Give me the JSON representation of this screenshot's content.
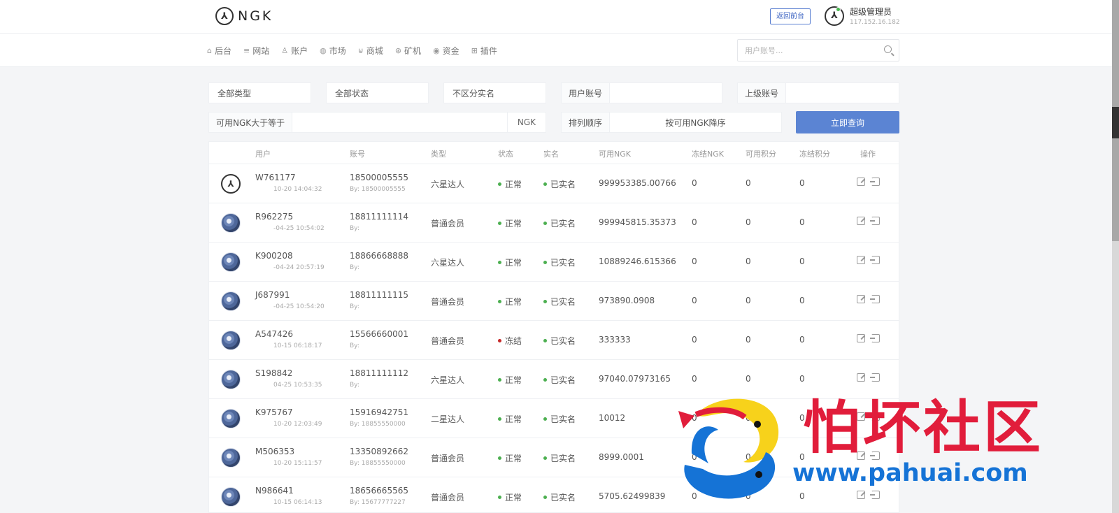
{
  "header": {
    "logo_mark": "⅄",
    "logo_text": "NGK",
    "back_button": "返回前台",
    "admin_name": "超级管理员",
    "admin_ip": "117.152.16.182"
  },
  "nav": {
    "items": [
      {
        "icon": "home-icon",
        "glyph": "⌂",
        "label": "后台"
      },
      {
        "icon": "list-icon",
        "glyph": "≡",
        "label": "网站"
      },
      {
        "icon": "users-icon",
        "glyph": "♙",
        "label": "账户"
      },
      {
        "icon": "globe-icon",
        "glyph": "◍",
        "label": "市场"
      },
      {
        "icon": "cart-icon",
        "glyph": "⊌",
        "label": "商城"
      },
      {
        "icon": "mining-icon",
        "glyph": "⊛",
        "label": "矿机"
      },
      {
        "icon": "money-icon",
        "glyph": "◉",
        "label": "资金"
      },
      {
        "icon": "plugin-icon",
        "glyph": "⊞",
        "label": "插件"
      }
    ],
    "search_placeholder": "用户账号..."
  },
  "filters": {
    "type": "全部类型",
    "status": "全部状态",
    "realname": "不区分实名",
    "account_label": "用户账号",
    "account_value": "",
    "parent_label": "上级账号",
    "parent_value": "",
    "ngk_label": "可用NGK大于等于",
    "ngk_value": "",
    "ngk_suffix": "NGK",
    "sort_label": "排列顺序",
    "sort_value": "按可用NGK降序",
    "query_button": "立即查询"
  },
  "table": {
    "headers": [
      "用户",
      "账号",
      "类型",
      "状态",
      "实名",
      "可用NGK",
      "冻结NGK",
      "可用积分",
      "冻结积分",
      "操作"
    ],
    "rows": [
      {
        "avatar": "logo",
        "uid": "W761177",
        "time": "10-20 14:04:32",
        "account": "18500005555",
        "by": "By: 18500005555",
        "type": "六星达人",
        "status": "正常",
        "status_color": "#4caf50",
        "realname": "已实名",
        "ngk": "999953385.00766",
        "frozen_ngk": "0",
        "points": "0",
        "frozen_points": "0"
      },
      {
        "avatar": "photo",
        "uid": "R962275",
        "time": "-04-25 10:54:02",
        "account": "18811111114",
        "by": "By:",
        "type": "普通会员",
        "status": "正常",
        "status_color": "#4caf50",
        "realname": "已实名",
        "ngk": "999945815.35373",
        "frozen_ngk": "0",
        "points": "0",
        "frozen_points": "0"
      },
      {
        "avatar": "photo",
        "uid": "K900208",
        "time": "-04-24 20:57:19",
        "account": "18866668888",
        "by": "By:",
        "type": "六星达人",
        "status": "正常",
        "status_color": "#4caf50",
        "realname": "已实名",
        "ngk": "10889246.615366",
        "frozen_ngk": "0",
        "points": "0",
        "frozen_points": "0"
      },
      {
        "avatar": "photo",
        "uid": "J687991",
        "time": "-04-25 10:54:20",
        "account": "18811111115",
        "by": "By:",
        "type": "普通会员",
        "status": "正常",
        "status_color": "#4caf50",
        "realname": "已实名",
        "ngk": "973890.0908",
        "frozen_ngk": "0",
        "points": "0",
        "frozen_points": "0"
      },
      {
        "avatar": "photo",
        "uid": "A547426",
        "time": "10-15 06:18:17",
        "account": "15566660001",
        "by": "By:",
        "type": "普通会员",
        "status": "冻结",
        "status_color": "#c62828",
        "realname": "已实名",
        "ngk": "333333",
        "frozen_ngk": "0",
        "points": "0",
        "frozen_points": "0"
      },
      {
        "avatar": "photo",
        "uid": "S198842",
        "time": "04-25 10:53:35",
        "account": "18811111112",
        "by": "By:",
        "type": "六星达人",
        "status": "正常",
        "status_color": "#4caf50",
        "realname": "已实名",
        "ngk": "97040.07973165",
        "frozen_ngk": "0",
        "points": "0",
        "frozen_points": "0"
      },
      {
        "avatar": "photo",
        "uid": "K975767",
        "time": "10-20 12:03:49",
        "account": "15916942751",
        "by": "By: 18855550000",
        "type": "二星达人",
        "status": "正常",
        "status_color": "#4caf50",
        "realname": "已实名",
        "ngk": "10012",
        "frozen_ngk": "0",
        "points": "0",
        "frozen_points": "0"
      },
      {
        "avatar": "photo",
        "uid": "M506353",
        "time": "10-20 15:11:57",
        "account": "13350892662",
        "by": "By: 18855550000",
        "type": "普通会员",
        "status": "正常",
        "status_color": "#4caf50",
        "realname": "已实名",
        "ngk": "8999.0001",
        "frozen_ngk": "0",
        "points": "0",
        "frozen_points": "0"
      },
      {
        "avatar": "photo",
        "uid": "N986641",
        "time": "10-15 06:14:13",
        "account": "18656665565",
        "by": "By: 15677777227",
        "type": "普通会员",
        "status": "正常",
        "status_color": "#4caf50",
        "realname": "已实名",
        "ngk": "5705.62499839",
        "frozen_ngk": "0",
        "points": "0",
        "frozen_points": "0"
      }
    ]
  },
  "watermark": {
    "title": "怕坏社区",
    "url": "www.pahuai.com"
  }
}
